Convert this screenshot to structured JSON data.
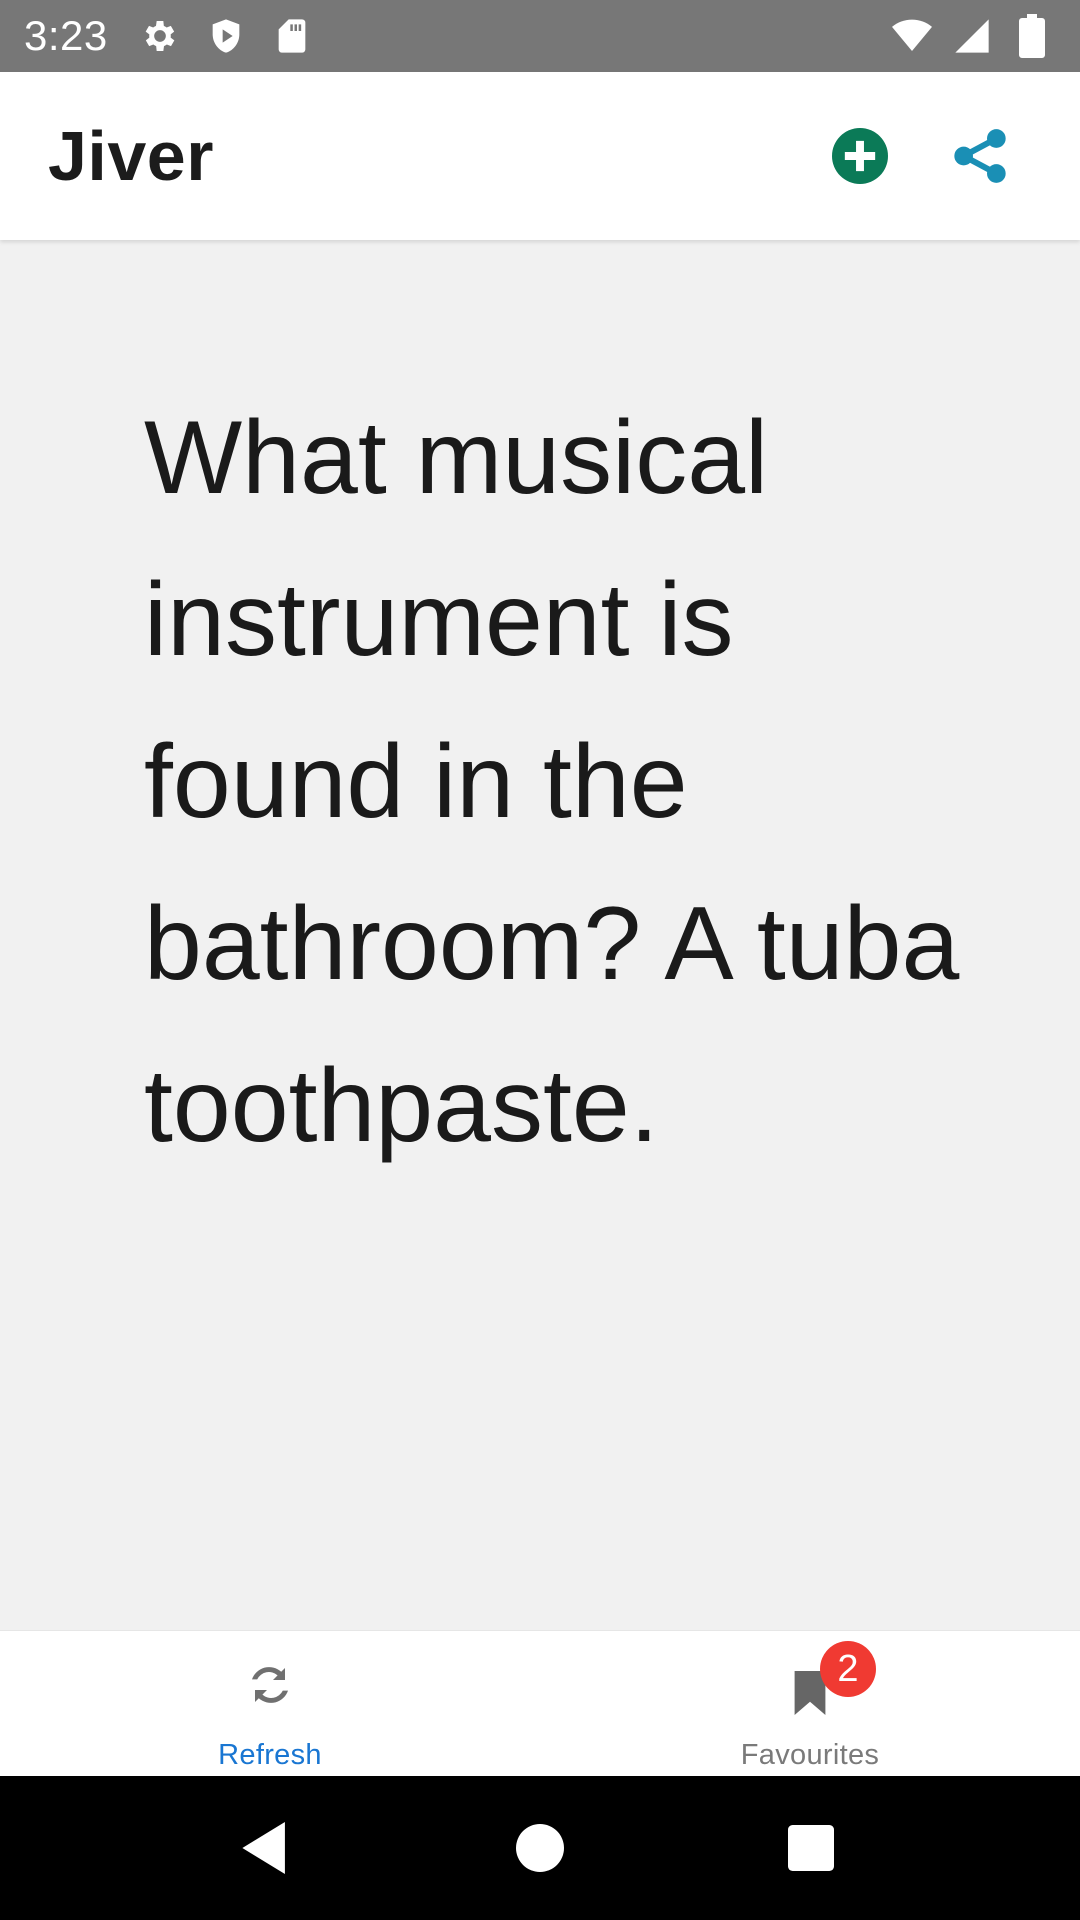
{
  "status_bar": {
    "time": "3:23",
    "left_icons": [
      "settings-icon",
      "shield-play-icon",
      "sd-card-icon"
    ],
    "right_icons": [
      "wifi-icon",
      "cell-signal-icon",
      "battery-icon"
    ]
  },
  "app_bar": {
    "title": "Jiver",
    "actions": [
      {
        "name": "add-icon",
        "color": "#0b7a57"
      },
      {
        "name": "share-icon",
        "color": "#1a8fb5"
      }
    ]
  },
  "content": {
    "joke": "What musical instrument is found in the bathroom? A tuba toothpaste."
  },
  "bottom_nav": {
    "items": [
      {
        "label": "Refresh",
        "icon": "refresh-icon",
        "active": true
      },
      {
        "label": "Favourites",
        "icon": "bookmark-icon",
        "active": false,
        "badge": "2"
      }
    ],
    "active_color": "#1976d2",
    "inactive_color": "#7a7a7a",
    "badge_color": "#f03a32"
  },
  "system_nav": {
    "buttons": [
      "back-icon",
      "home-icon",
      "recents-icon"
    ]
  }
}
